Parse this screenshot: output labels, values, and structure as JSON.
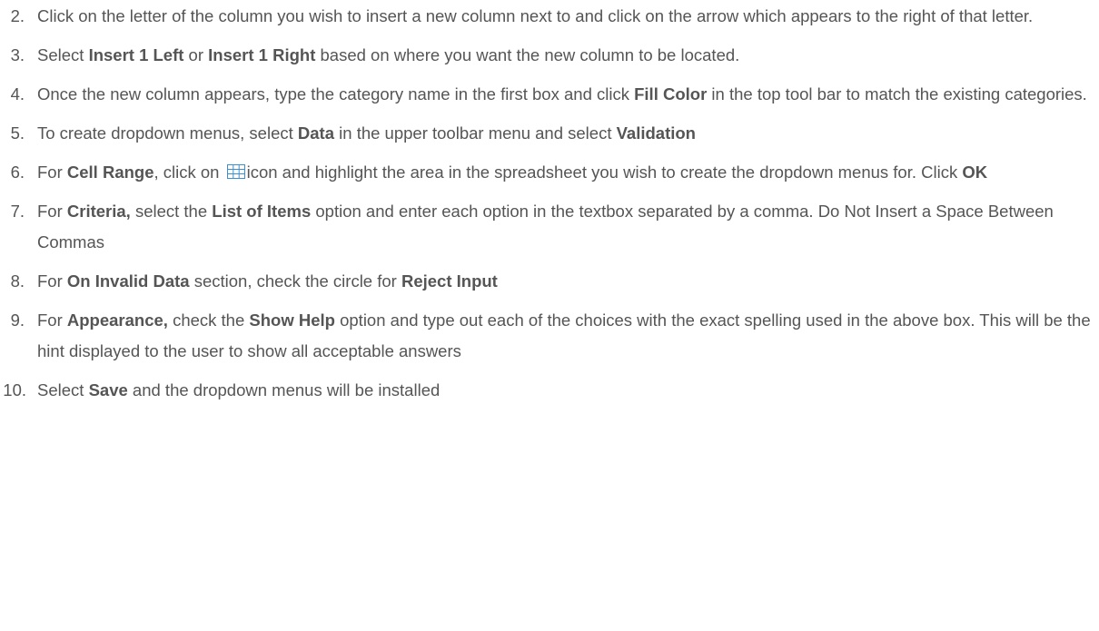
{
  "steps": [
    {
      "number": "2.",
      "parts": [
        {
          "text": "Click on the letter of the column you wish to insert a new column next to and click on the arrow which appears to the right of that letter.",
          "bold": false
        }
      ]
    },
    {
      "number": "3.",
      "parts": [
        {
          "text": "Select ",
          "bold": false
        },
        {
          "text": "Insert 1 Left",
          "bold": true
        },
        {
          "text": " or ",
          "bold": false
        },
        {
          "text": "Insert 1 Right",
          "bold": true
        },
        {
          "text": " based on where you want the new column to be located.",
          "bold": false
        }
      ]
    },
    {
      "number": "4.",
      "parts": [
        {
          "text": "Once the new column appears, type the category name in the first box and click ",
          "bold": false
        },
        {
          "text": "Fill Color",
          "bold": true
        },
        {
          "text": " in the top tool bar to match the existing categories.",
          "bold": false
        }
      ]
    },
    {
      "number": "5.",
      "parts": [
        {
          "text": "To create dropdown menus, select ",
          "bold": false
        },
        {
          "text": "Data",
          "bold": true
        },
        {
          "text": " in the upper toolbar menu and select ",
          "bold": false
        },
        {
          "text": "Validation",
          "bold": true
        }
      ]
    },
    {
      "number": "6.",
      "parts": [
        {
          "text": "For ",
          "bold": false
        },
        {
          "text": "Cell Range",
          "bold": true
        },
        {
          "text": ", click on ",
          "bold": false
        },
        {
          "icon": "grid-icon"
        },
        {
          "text": "icon and highlight the area in the spreadsheet you wish to create the dropdown menus for.  Click ",
          "bold": false
        },
        {
          "text": "OK",
          "bold": true
        }
      ]
    },
    {
      "number": "7.",
      "parts": [
        {
          "text": "For ",
          "bold": false
        },
        {
          "text": "Criteria,",
          "bold": true
        },
        {
          "text": " select the ",
          "bold": false
        },
        {
          "text": "List of Items",
          "bold": true
        },
        {
          "text": " option and enter each option in the textbox separated by a comma. Do Not Insert a Space Between Commas",
          "bold": false
        }
      ]
    },
    {
      "number": "8.",
      "parts": [
        {
          "text": "For ",
          "bold": false
        },
        {
          "text": "On Invalid Data",
          "bold": true
        },
        {
          "text": " section, check the circle for ",
          "bold": false
        },
        {
          "text": "Reject Input",
          "bold": true
        }
      ]
    },
    {
      "number": "9.",
      "parts": [
        {
          "text": "For ",
          "bold": false
        },
        {
          "text": "Appearance,",
          "bold": true
        },
        {
          "text": " check the ",
          "bold": false
        },
        {
          "text": "Show Help",
          "bold": true
        },
        {
          "text": " option and type out each of the choices with the exact spelling used in the above box. This will be the hint displayed to the user to show all acceptable answers",
          "bold": false
        }
      ]
    },
    {
      "number": "10.",
      "parts": [
        {
          "text": "Select ",
          "bold": false
        },
        {
          "text": "Save",
          "bold": true
        },
        {
          "text": " and the dropdown menus will be installed",
          "bold": false
        }
      ]
    }
  ],
  "colors": {
    "text": "#555555",
    "icon_stroke": "#3d8fd1",
    "background": "#ffffff"
  }
}
